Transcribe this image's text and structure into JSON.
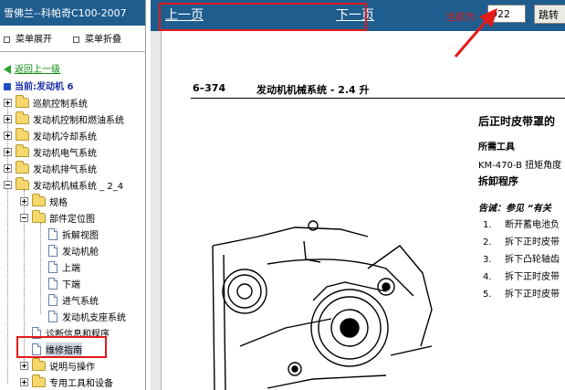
{
  "app": {
    "title": "雪佛兰--科帕奇C100-2007"
  },
  "sidebar": {
    "expand_label": "菜单展开",
    "collapse_label": "菜单折叠",
    "back_label": "返回上一级",
    "current_label": "当前:发动机 6",
    "tree": {
      "n1": "巡航控制系统",
      "n2": "发动机控制和燃油系统",
      "n3": "发动机冷却系统",
      "n4": "发动机电气系统",
      "n5": "发动机排气系统",
      "n6": "发动机机械系统 _ 2_4",
      "n6_1": "规格",
      "n6_2": "部件定位图",
      "n6_2_1": "拆解视图",
      "n6_2_2": "发动机舱",
      "n6_2_3": "上端",
      "n6_2_4": "下端",
      "n6_2_5": "进气系统",
      "n6_2_6": "发动机支座系统",
      "n6_3": "诊断信息和程序",
      "n6_4": "维修指南",
      "n6_5": "说明与操作",
      "n6_6": "专用工具和设备"
    }
  },
  "toolbar": {
    "prev_label": "上一页",
    "next_label": "下一页",
    "current_page_label": "当前为",
    "page_value": "922",
    "jump_label": "跳转"
  },
  "document": {
    "page_number": "6–374",
    "page_header": "发动机机械系统 - 2.4 升",
    "section_title": "后正时皮带罩的",
    "tools_heading": "所需工具",
    "tool_1": "KM-470-B 扭矩角度",
    "procedure_heading": "拆卸程序",
    "notice": "告诫：参见 “有关",
    "steps": [
      {
        "n": "1.",
        "text": "断开蓄电池负"
      },
      {
        "n": "2.",
        "text": "拆下正时皮带"
      },
      {
        "n": "3.",
        "text": "拆下凸轮轴齿"
      },
      {
        "n": "4.",
        "text": "拆下正时皮带"
      },
      {
        "n": "5.",
        "text": "拆下正时皮带"
      }
    ]
  },
  "colors": {
    "toolbar_bg": "#1f5d8f",
    "highlight": "#e11b1b",
    "link_green": "#0b8a0b",
    "current_blue": "#1c2fa8"
  }
}
